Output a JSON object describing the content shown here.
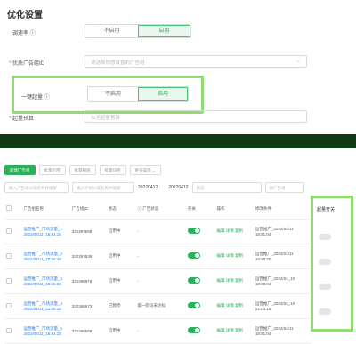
{
  "page": {
    "section_title": "优化设置"
  },
  "form": {
    "row1": {
      "label": "调速率 ⓘ",
      "opt_a": "不启用",
      "opt_b": "启用"
    },
    "row2": {
      "label": "* 优质广告组ID",
      "placeholder": "请选择你想设置的广告组"
    },
    "row3": {
      "label": "一键起量 ⓘ",
      "opt_a": "不启用",
      "opt_b": "启用"
    },
    "row4": {
      "label": "* 起量预算",
      "placeholder": "以元起量预算"
    }
  },
  "toolbar": {
    "items": [
      "新建广告组",
      "批量启用",
      "批量删除",
      "批量归档",
      "更多操作 ⌄"
    ]
  },
  "filters": {
    "f1": "输入广告组ID或名称并搜索",
    "f2": "输入计划ID或名称并搜索",
    "date_from": "20220412",
    "date_to": "20220412",
    "status": "状态",
    "search": "搜广告组"
  },
  "table": {
    "headers": [
      "",
      "广告组名称",
      "广告组ID",
      "状态",
      "ⓘ 广告状态",
      "开关",
      "操作",
      "修改条件"
    ],
    "rows": [
      {
        "name": "运营推广_市场流量_1",
        "date": "2022/04/11_16:51:18",
        "id": "330397598",
        "status": "启用中",
        "ad": "-",
        "on": true,
        "op": "编辑 详情 复制",
        "cond": "运营推广_2022/04/11",
        "time": "18:51:04"
      },
      {
        "name": "运营推广_市场流量_2",
        "date": "2022/04/11_18:56:48",
        "id": "330397539",
        "status": "启用中",
        "ad": "-",
        "on": true,
        "op": "编辑 详情 复制",
        "cond": "运营推广_2022/04/11",
        "time": "18:56:20"
      },
      {
        "name": "运营推广_市场流量_3",
        "date": "2022/04/11_18:36:08",
        "id": "330396978",
        "status": "启用中",
        "ad": "-",
        "on": true,
        "op": "编辑 详情 复制",
        "cond": "运营推广_2022/04_10",
        "time": "18:38:04"
      },
      {
        "name": "运营推广_市场流量_4",
        "date": "2022/04/11_22:05:10",
        "id": "330365673",
        "status": "已暂停",
        "ad": "第一阶段未达标",
        "on": true,
        "op": "编辑 详情 复制",
        "cond": "运营推广_2022/04_10",
        "time": "22:03:19"
      },
      {
        "name": "运营推广_市场流量_5",
        "date": "2022/04/11_16:51:18",
        "id": "330365588",
        "status": "启用中",
        "ad": "-",
        "on": true,
        "op": "编辑 详情 复制",
        "cond": "运营推广_2022/04/11",
        "time": "18:51:04"
      }
    ]
  },
  "batch": {
    "title": "起量开关"
  }
}
